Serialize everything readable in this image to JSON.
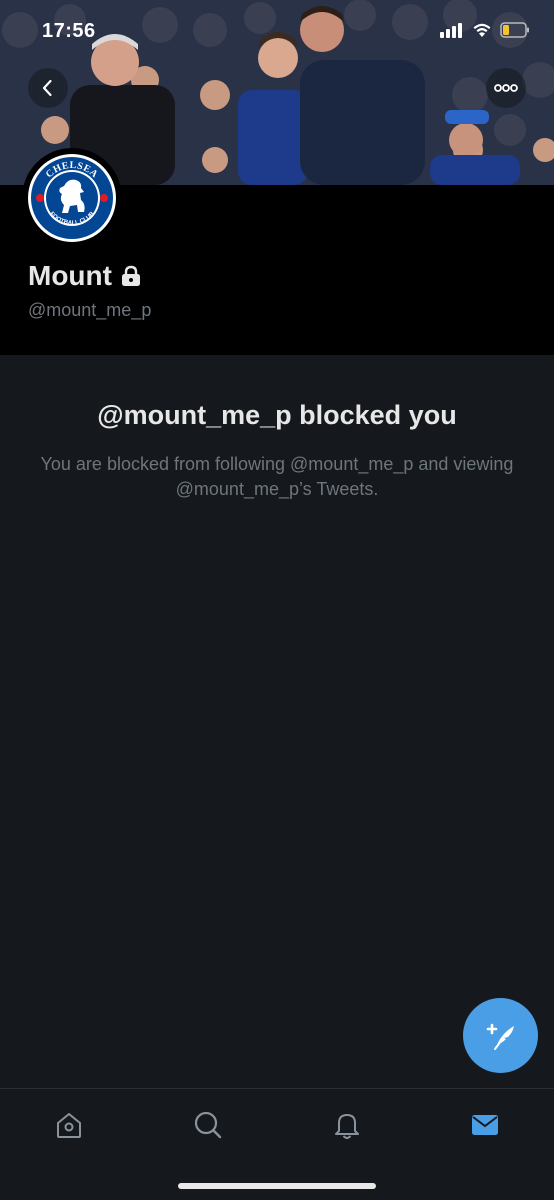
{
  "status_bar": {
    "time": "17:56"
  },
  "header": {
    "back_icon": "chevron-left-icon",
    "more_icon": "more-horizontal-icon"
  },
  "profile": {
    "name": "Mount",
    "handle": "@mount_me_p",
    "locked_icon": "lock-icon",
    "avatar": {
      "label": "Chelsea Football Club crest",
      "text_top": "CHELSEA",
      "text_bottom": "FOOTBALL CLUB"
    }
  },
  "blocked": {
    "title": "@mount_me_p blocked you",
    "description": "You are blocked from following @mount_me_p and viewing @mount_me_p’s Tweets."
  },
  "fab": {
    "icon": "compose-tweet-icon"
  },
  "tabbar": {
    "items": [
      {
        "icon": "home-icon",
        "active": false
      },
      {
        "icon": "search-icon",
        "active": false
      },
      {
        "icon": "notifications-bell-icon",
        "active": false
      },
      {
        "icon": "messages-envelope-icon",
        "active": true
      }
    ]
  },
  "colors": {
    "background": "#15181c",
    "accent": "#4a9ee6",
    "text_primary": "#e7e7e7",
    "text_secondary": "#6e767d"
  }
}
